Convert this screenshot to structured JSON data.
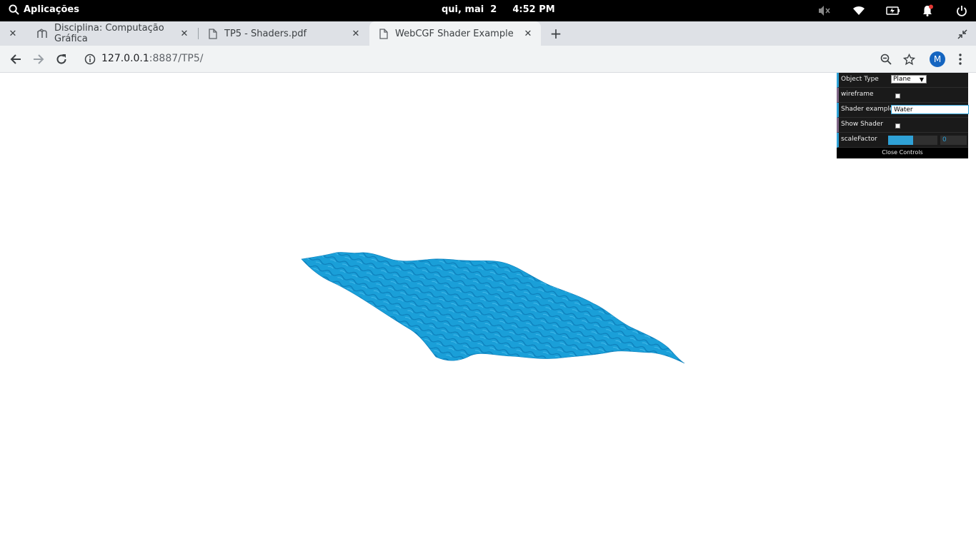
{
  "system": {
    "apps_label": "Aplicações",
    "date": "qui, mai  2",
    "time": "4:52 PM",
    "icons": [
      "search-icon",
      "volume-muted-icon",
      "wifi-icon",
      "battery-icon",
      "notification-bell-icon",
      "power-icon"
    ]
  },
  "tabs": [
    {
      "title": "Disciplina: Computação Gráfica",
      "icon": "moodle-icon",
      "active": false
    },
    {
      "title": "TP5 - Shaders.pdf",
      "icon": "document-icon",
      "active": false
    },
    {
      "title": "WebCGF Shader Example",
      "icon": "document-icon",
      "active": true
    }
  ],
  "toolbar": {
    "url_host": "127.0.0.1",
    "url_rest": ":8887/TP5/",
    "avatar_letter": "M"
  },
  "gui": {
    "rows": [
      {
        "label": "Object Type",
        "type": "select",
        "value": "Plane"
      },
      {
        "label": "wireframe",
        "type": "checkbox",
        "checked": false
      },
      {
        "label": "Shader examples",
        "type": "text",
        "value": "Water"
      },
      {
        "label": "Show Shader",
        "type": "checkbox",
        "checked": false
      },
      {
        "label": "scaleFactor",
        "type": "number",
        "value": "0",
        "fill_fraction": 0.5
      }
    ],
    "close_label": "Close Controls"
  },
  "colors": {
    "water": "#1a9fd8",
    "water_dark": "#0d7fbb",
    "gui_bg": "#1a1a1a",
    "accent": "#2fa1d6"
  }
}
